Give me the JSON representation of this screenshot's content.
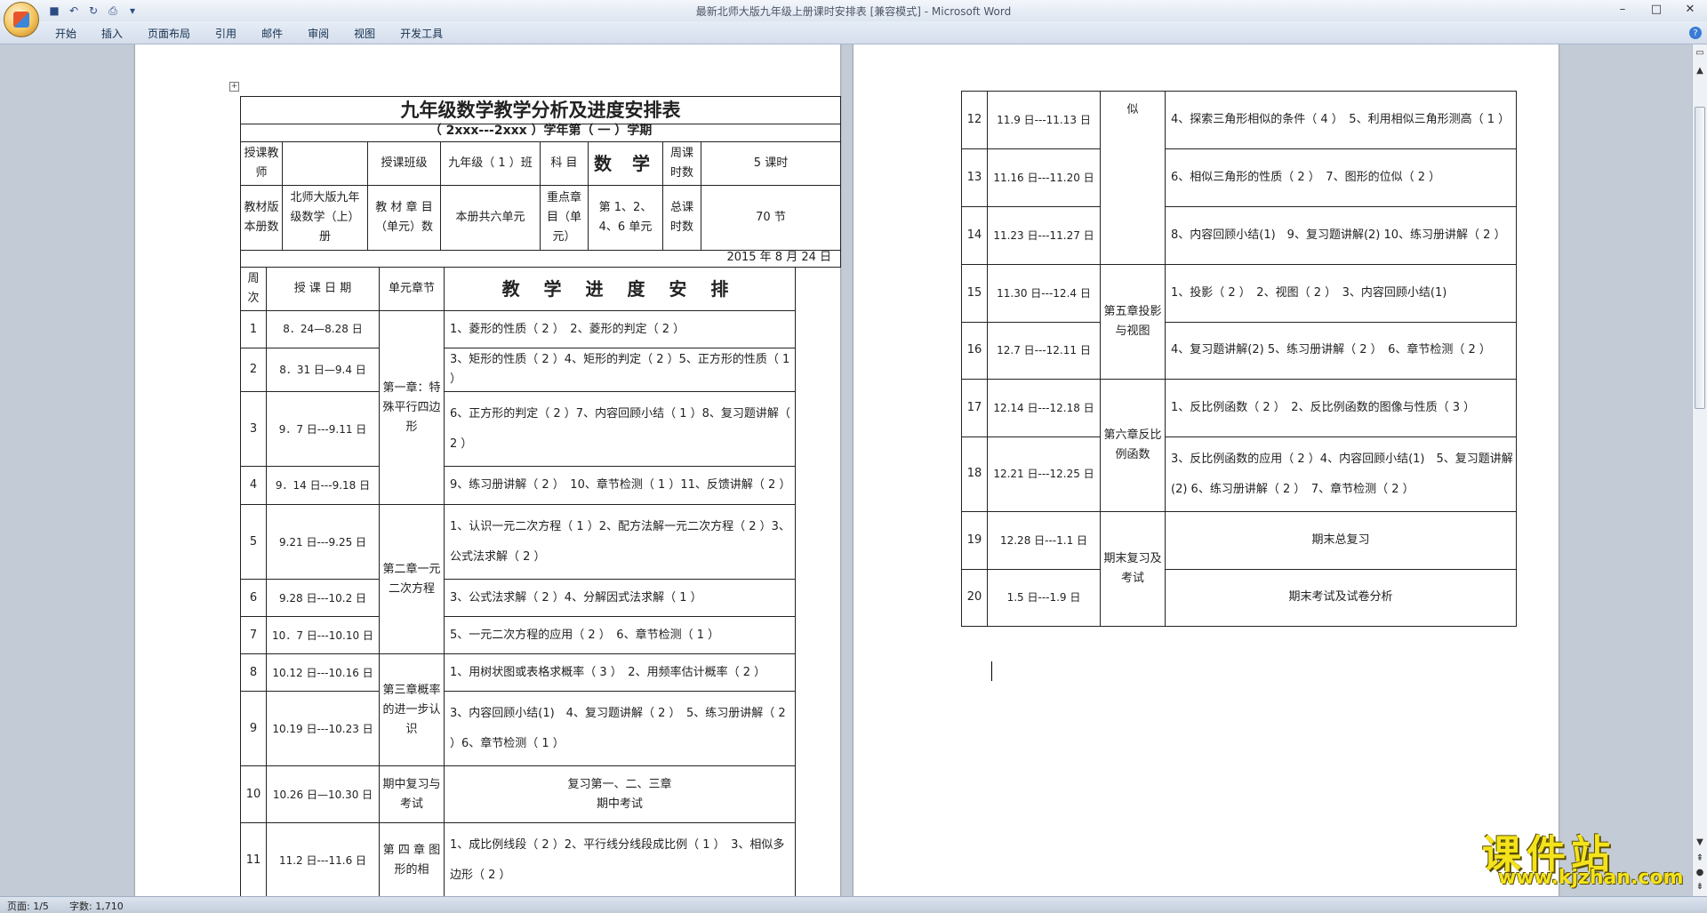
{
  "window": {
    "title": "最新北师大版九年级上册课时安排表 [兼容模式] - Microsoft Word"
  },
  "ribbon": {
    "tabs": [
      "开始",
      "插入",
      "页面布局",
      "引用",
      "邮件",
      "审阅",
      "视图",
      "开发工具"
    ]
  },
  "doc": {
    "title": "九年级数学教学分析及进度安排表",
    "year_line": "（ 2xxx---2xxx ）学年第（ 一 ）学期",
    "info": {
      "teacher_label": "授课教师",
      "teacher_value": "",
      "class_label": "授课班级",
      "class_value": "九年级（ 1 ）班",
      "subject_label": "科 目",
      "subject_value": "数 学",
      "weekly_label": "周课时数",
      "weekly_value": "5 课时",
      "textbook_label": "教材版本册数",
      "textbook_value": "北师大版九年级数学（上）册",
      "chapters_label": "教 材 章 目（单元）数",
      "chapters_value": "本册共六单元",
      "key_label": "重点章目（单元）",
      "key_value": "第 1、2、4、6 单元",
      "total_label": "总课时数",
      "total_value": "70 节"
    },
    "date": "2015 年 8 月 24 日",
    "schedule_header": {
      "week": "周次",
      "date": "授 课 日 期",
      "unit": "单元章节",
      "plan": "教 学 进 度 安 排"
    },
    "units": {
      "u1": "第一章：特殊平行四边形",
      "u2": "第二章一元二次方程",
      "u3": "第三章概率的进一步认识",
      "u_mid": "期中复习与考试",
      "u4": "第 四 章 图形的相",
      "u4b": "似",
      "u5": "第五章投影与视图",
      "u6": "第六章反比例函数",
      "u_final": "期末复习及考试"
    },
    "weeks": [
      {
        "wk": "1",
        "date": "8．24—8.28 日",
        "plan": "1、菱形的性质（ 2 ）　2、菱形的判定（ 2 ）"
      },
      {
        "wk": "2",
        "date": "8．31 日—9.4 日",
        "plan": "3、矩形的性质（ 2 ）4、矩形的判定（ 2 ）5、正方形的性质（ 1 ）"
      },
      {
        "wk": "3",
        "date": "9．7 日---9.11 日",
        "plan": "6、正方形的判定（ 2 ）7、内容回顾小结（ 1 ）8、复习题讲解（ 2 ）"
      },
      {
        "wk": "4",
        "date": "9．14 日---9.18 日",
        "plan": "9、练习册讲解（ 2 ）　10、章节检测（ 1 ）11、反馈讲解（ 2 ）"
      },
      {
        "wk": "5",
        "date": "9.21 日---9.25 日",
        "plan": "1、认识一元二次方程（ 1 ）2、配方法解一元二次方程（ 2 ）3、公式法求解（ 2 ）"
      },
      {
        "wk": "6",
        "date": "9.28 日---10.2 日",
        "plan": "3、公式法求解（ 2 ）4、分解因式法求解（ 1 ）"
      },
      {
        "wk": "7",
        "date": "10．7 日---10.10 日",
        "plan": "5、一元二次方程的应用（ 2 ）　6、章节检测（ 1 ）"
      },
      {
        "wk": "8",
        "date": "10.12 日---10.16 日",
        "plan": "1、用树状图或表格求概率（ 3 ）　2、用频率估计概率（ 2 ）"
      },
      {
        "wk": "9",
        "date": "10.19 日---10.23 日",
        "plan": "3、内容回顾小结(1)　4、复习题讲解（ 2 ）　5、练习册讲解（ 2 ）6、章节检测（ 1 ）"
      },
      {
        "wk": "10",
        "date": "10.26 日—10.30 日",
        "plan": "复习第一、二、三章",
        "plan2": "期中考试"
      },
      {
        "wk": "11",
        "date": "11.2 日---11.6 日",
        "plan": "1、成比例线段（ 2 ）2、平行线分线段成比例（ 1 ）　3、相似多边形（ 2 ）"
      },
      {
        "wk": "12",
        "date": "11.9 日---11.13 日",
        "plan": "4、探索三角形相似的条件（ 4 ）　5、利用相似三角形测高（ 1 ）"
      },
      {
        "wk": "13",
        "date": "11.16 日---11.20 日",
        "plan": "6、相似三角形的性质（ 2 ）　7、图形的位似（ 2 ）"
      },
      {
        "wk": "14",
        "date": "11.23 日---11.27 日",
        "plan": "8、内容回顾小结(1)　9、复习题讲解(2) 10、练习册讲解（ 2 ）"
      },
      {
        "wk": "15",
        "date": "11.30 日---12.4 日",
        "plan": "1、投影（ 2 ）　2、视图（ 2 ）　3、内容回顾小结(1)"
      },
      {
        "wk": "16",
        "date": "12.7 日---12.11 日",
        "plan": "4、复习题讲解(2) 5、练习册讲解（ 2 ）　6、章节检测（ 2 ）"
      },
      {
        "wk": "17",
        "date": "12.14 日---12.18 日",
        "plan": "1、反比例函数（ 2 ）　2、反比例函数的图像与性质（ 3 ）"
      },
      {
        "wk": "18",
        "date": "12.21 日---12.25 日",
        "plan": "3、反比例函数的应用（ 2 ）4、内容回顾小结(1)　5、复习题讲解(2) 6、练习册讲解（ 2 ）　7、章节检测（ 2 ）"
      },
      {
        "wk": "19",
        "date": "12.28 日---1.1 日",
        "plan": "期末总复习"
      },
      {
        "wk": "20",
        "date": "1.5 日---1.9 日",
        "plan": "期末考试及试卷分析"
      }
    ]
  },
  "status": {
    "page": "页面: 1/5",
    "words": "字数: 1,710"
  },
  "watermark": {
    "line1": "课件站",
    "line2": "www.kjzhan.com"
  }
}
